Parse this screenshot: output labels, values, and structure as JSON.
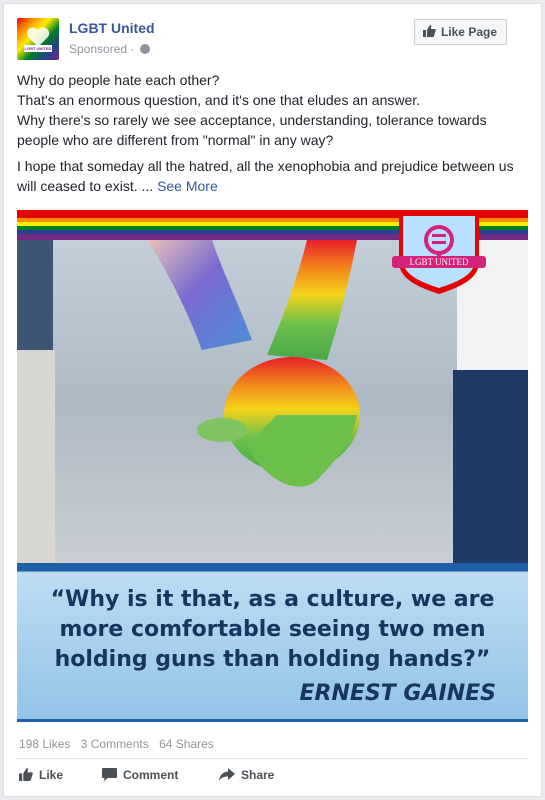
{
  "post": {
    "page_name": "LGBT United",
    "sponsored": "Sponsored",
    "like_page_label": "Like Page",
    "avatar_tag": "LGBT UNITED",
    "paragraphs": [
      "Why do people hate each other?",
      "That's an enormous question, and it's one that eludes an answer.",
      "Why there's so rarely we see acceptance, understanding, tolerance towards people who are different from \"normal\" in any way?",
      "I hope that someday all the hatred, all the xenophobia and prejudice between us will ceased to exist. ..."
    ],
    "see_more": "See More"
  },
  "image": {
    "logo_text": "LGBT UNITED",
    "quote_lines": [
      "“Why is it that, as a culture, we are",
      "more comfortable seeing two men",
      "holding guns than holding hands?”"
    ],
    "author": "ERNEST GAINES"
  },
  "stats": {
    "likes": "198 Likes",
    "comments": "3 Comments",
    "shares": "64 Shares"
  },
  "actions": {
    "like": "Like",
    "comment": "Comment",
    "share": "Share"
  },
  "colors": {
    "link": "#365899",
    "muted": "#90949c",
    "quote": "#17355f",
    "quote_bar": "#1e5fa8"
  }
}
